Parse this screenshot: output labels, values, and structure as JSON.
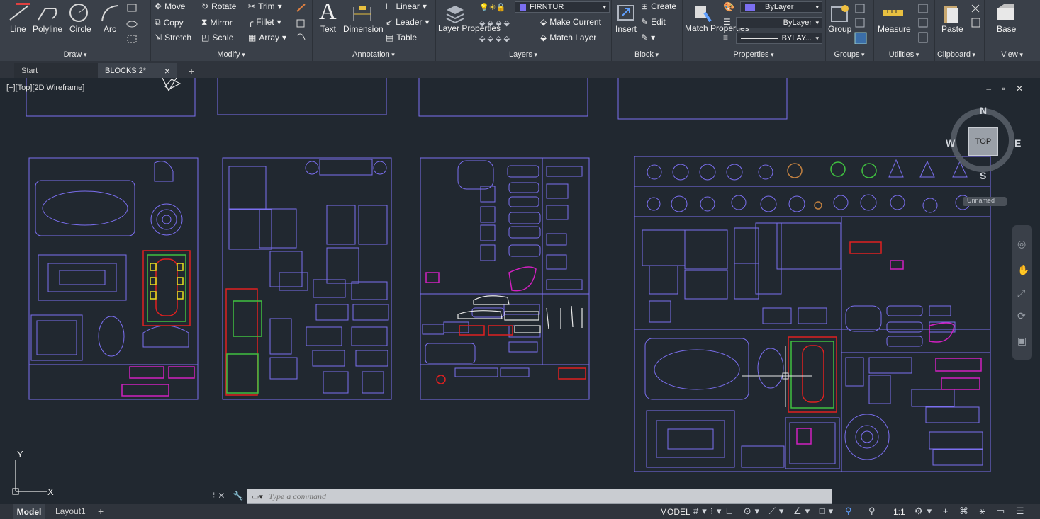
{
  "ribbon": {
    "draw": {
      "title": "Draw",
      "line": "Line",
      "polyline": "Polyline",
      "circle": "Circle",
      "arc": "Arc"
    },
    "modify": {
      "title": "Modify",
      "move": "Move",
      "rotate": "Rotate",
      "trim": "Trim",
      "copy": "Copy",
      "mirror": "Mirror",
      "fillet": "Fillet",
      "stretch": "Stretch",
      "scale": "Scale",
      "array": "Array"
    },
    "annotation": {
      "title": "Annotation",
      "text": "Text",
      "dimension": "Dimension",
      "linear": "Linear",
      "leader": "Leader",
      "table": "Table"
    },
    "layers": {
      "title": "Layers",
      "layer_properties": "Layer Properties",
      "current_layer": "FIRNTUR",
      "make_current": "Make Current",
      "match_layer": "Match Layer"
    },
    "block": {
      "title": "Block",
      "insert": "Insert",
      "create": "Create",
      "edit": "Edit"
    },
    "properties": {
      "title": "Properties",
      "match_properties": "Match Properties",
      "color": "ByLayer",
      "linetype": "ByLayer",
      "lineweight": "BYLAY..."
    },
    "groups": {
      "title": "Groups",
      "group": "Group"
    },
    "utilities": {
      "title": "Utilities",
      "measure": "Measure"
    },
    "clipboard": {
      "title": "Clipboard",
      "paste": "Paste"
    },
    "view": {
      "title": "View",
      "base": "Base"
    }
  },
  "tabs": {
    "start": "Start",
    "active": "BLOCKS 2*",
    "close": "×",
    "new": "+"
  },
  "viewport": {
    "label": "[−][Top][2D Wireframe]",
    "compass": {
      "n": "N",
      "s": "S",
      "e": "E",
      "w": "W",
      "top": "TOP"
    },
    "ucs": "Unnamed",
    "axis_x": "X",
    "axis_y": "Y"
  },
  "command": {
    "placeholder": "Type a command"
  },
  "layout_tabs": {
    "model": "Model",
    "layout1": "Layout1",
    "add": "+"
  },
  "status": {
    "model": "MODEL",
    "scale": "1:1"
  },
  "colors": {
    "accent": "#7b6ff0",
    "red": "#e02020",
    "green": "#40c040",
    "yellow": "#e8e020",
    "magenta": "#d020c0"
  }
}
